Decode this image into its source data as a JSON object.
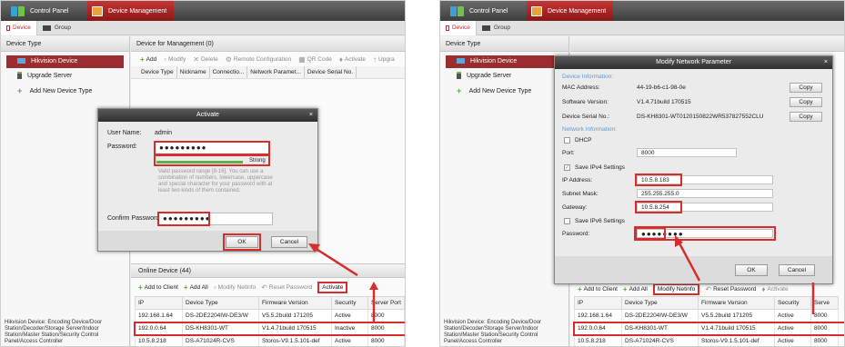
{
  "left": {
    "topbar": {
      "control_panel": "Control Panel",
      "device_management": "Device Management"
    },
    "subtabs": {
      "device": "Device",
      "group": "Group"
    },
    "sidebar": {
      "title": "Device Type",
      "items": [
        "Hikvision Device",
        "Upgrade Server",
        "Add New Device Type"
      ],
      "description": "Hikvision Device: Encoding Device/Door Station/Decoder/Storage Server/Indoor Station/Master Station/Security Control Panel/Access Controller"
    },
    "main": {
      "title": "Device for Management (0)",
      "toolbar": [
        "Add",
        "Modify",
        "Delete",
        "Remote Configuration",
        "QR Code",
        "Activate",
        "Upgra"
      ],
      "columns": [
        "Device Type",
        "Nickname",
        "Connectio...",
        "Network Paramet...",
        "Device Serial No."
      ]
    },
    "online": {
      "title": "Online Device (44)",
      "toolbar": [
        "Add to Client",
        "Add All",
        "Modify Netinfo",
        "Reset Password",
        "Activate"
      ],
      "columns": [
        "IP",
        "Device Type",
        "Firmware Version",
        "Security",
        "Server Port"
      ],
      "rows": [
        [
          "192.168.1.64",
          "DS-2DE2204IW-DE3/W",
          "V5.5.2build 171205",
          "Active",
          "8000"
        ],
        [
          "192.0.0.64",
          "DS-KH8301-WT",
          "V1.4.71build 170515",
          "Inactive",
          "8000"
        ],
        [
          "10.5.8.218",
          "DS-A71024R-CVS",
          "Storos-V9.1.5.101-def",
          "Active",
          "8000"
        ]
      ]
    },
    "dialog": {
      "title": "Activate",
      "close": "×",
      "user_name_label": "User Name:",
      "user_name_value": "admin",
      "password_label": "Password:",
      "password_value": "●●●●●●●●●",
      "strength": "Strong",
      "hint": "Valid password range [8-16]. You can use a combination of numbers, lowercase, uppercase and special character for your password with at least two kinds of them contained.",
      "confirm_label": "Confirm Password:",
      "confirm_value": "●●●●●●●●●",
      "ok": "OK",
      "cancel": "Cancel"
    }
  },
  "right": {
    "topbar": {
      "control_panel": "Control Panel",
      "device_management": "Device Management"
    },
    "subtabs": {
      "device": "Device",
      "group": "Group"
    },
    "sidebar": {
      "title": "Device Type",
      "items": [
        "Hikvision Device",
        "Upgrade Server",
        "Add New Device Type"
      ],
      "description": "Hikvision Device: Encoding Device/Door Station/Decoder/Storage Server/Indoor Station/Master Station/Security Control Panel/Access Controller"
    },
    "online": {
      "toolbar": [
        "Add to Client",
        "Add All",
        "Modify Netinfo",
        "Reset Password",
        "Activate"
      ],
      "columns": [
        "IP",
        "Device Type",
        "Firmware Version",
        "Security",
        "Serve"
      ],
      "rows": [
        [
          "192.168.1.64",
          "DS-2DE2204IW-DE3/W",
          "V5.5.2build 171205",
          "Active",
          "8000"
        ],
        [
          "192.0.0.64",
          "DS-KH8301-WT",
          "V1.4.71build 170515",
          "Active",
          "8000"
        ],
        [
          "10.5.8.218",
          "DS-A71024R-CVS",
          "Storos-V9.1.5.101-def",
          "Active",
          "8000"
        ]
      ]
    },
    "dialog": {
      "title": "Modify Network Parameter",
      "close": "×",
      "device_info_section": "Device Information:",
      "mac_label": "MAC Address:",
      "mac_value": "44-19-b6-c1-98-0e",
      "software_label": "Software Version:",
      "software_value": "V1.4.71build 170515",
      "serial_label": "Device Serial No.:",
      "serial_value": "DS-KH8301-WT0120150822WR537827552CLU",
      "copy": "Copy",
      "network_section": "Network Information:",
      "dhcp": "DHCP",
      "port_label": "Port:",
      "port_value": "8000",
      "save_ipv4": "Save IPv4 Settings",
      "ip_label": "IP Address:",
      "ip_value": "10.5.8.183",
      "mask_label": "Subnet Mask:",
      "mask_value": "255.255.255.0",
      "gateway_label": "Gateway:",
      "gateway_value": "10.5.8.254",
      "save_ipv6": "Save IPv6 Settings",
      "password_label": "Password:",
      "password_value": "●●●●●●●●",
      "ok": "OK",
      "cancel": "Cancel"
    }
  },
  "colors": {
    "accent_red": "#d62d2d",
    "selected_row": "#9b2d30",
    "section_blue": "#5b9bd5",
    "strength_green": "#5bb34a"
  },
  "icons": [
    "control-panel-icon",
    "device-management-icon",
    "device-icon",
    "group-icon",
    "hikvision-device-icon",
    "upgrade-server-icon",
    "add-icon",
    "close-icon",
    "check-icon"
  ]
}
